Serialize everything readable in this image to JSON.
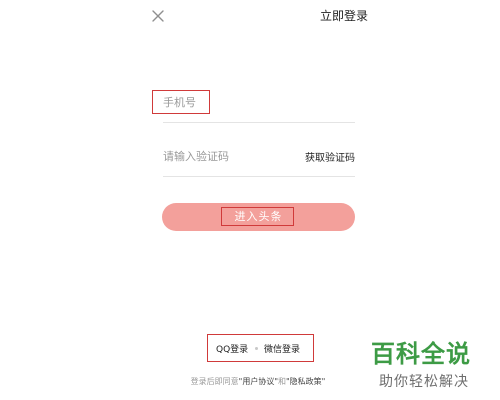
{
  "header": {
    "close_icon": "close-icon",
    "login_link": "立即登录"
  },
  "form": {
    "phone_placeholder": "手机号",
    "code_placeholder": "请输入验证码",
    "get_code_label": "获取验证码",
    "enter_button": "进入头条"
  },
  "social": {
    "qq_label": "QQ登录",
    "wechat_label": "微信登录"
  },
  "agreement": {
    "prefix": "登录后即同意",
    "user_agreement": "\"用户协议\"",
    "and": "和",
    "privacy_policy": "\"隐私政策\""
  },
  "watermark": {
    "title": "百科全说",
    "subtitle": "助你轻松解决"
  },
  "colors": {
    "enter_button_bg": "#f3a09b",
    "annotation_box": "#d03a3a",
    "watermark_green": "#3d9b45"
  }
}
